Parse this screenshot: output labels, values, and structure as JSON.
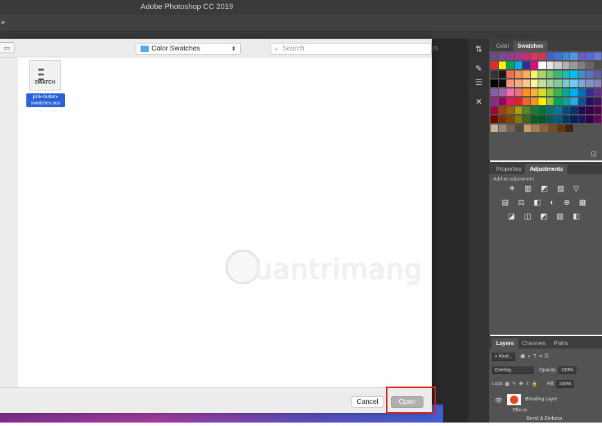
{
  "app": {
    "title": "Adobe Photoshop CC 2019",
    "menu_fragment": "e"
  },
  "document_tab_fragment": "25",
  "dialog": {
    "location": "Color Swatches",
    "search_placeholder": "Search",
    "files": [
      {
        "icon_label": "SWATCH",
        "name": "pink-button-swatches.aco",
        "selected": true
      }
    ],
    "cancel_label": "Cancel",
    "open_label": "Open",
    "open_highlight_color": "#e0211a"
  },
  "watermark": {
    "text": "uantrimang"
  },
  "color_panel": {
    "tabs": [
      "Color",
      "Swatches"
    ],
    "active_tab": "Swatches",
    "swatch_rows": [
      [
        "#6b4a8c",
        "#7b4a9b",
        "#8f3e93",
        "#a8368c",
        "#c0307a",
        "#d23a63",
        "#c73a4a",
        "#4a5fbe",
        "#3d74d3",
        "#3e8ad6",
        "#4c9be0",
        "#6b5ad0",
        "#5b68d8",
        "#6a7bdc"
      ],
      [
        "#f1252a",
        "#fff200",
        "#00a651",
        "#00aeef",
        "#2e3192",
        "#ec008c",
        "#ffffff",
        "#e6e6e6",
        "#cccccc",
        "#b3b3b3",
        "#999999",
        "#808080",
        "#666666",
        "#4d4d4d"
      ],
      [
        "#333333",
        "#1a1a1a",
        "#f26c4f",
        "#f68e55",
        "#fbaf5c",
        "#fff467",
        "#acd372",
        "#7cc576",
        "#3bb878",
        "#1abbb4",
        "#00bff3",
        "#438ccb",
        "#5574b9",
        "#605ca8"
      ],
      [
        "#000000",
        "#0d0d0d",
        "#f7977a",
        "#f9ad81",
        "#fdc68c",
        "#fff79a",
        "#c4df9b",
        "#a2d39c",
        "#82ca9c",
        "#7accc8",
        "#6dcff6",
        "#7da7d8",
        "#8393ca",
        "#8882be"
      ],
      [
        "#855fa8",
        "#a763a9",
        "#f06eaa",
        "#f26d7d",
        "#f7941d",
        "#fcb040",
        "#d7df23",
        "#8dc63f",
        "#39b54a",
        "#00a99d",
        "#00aeef",
        "#0072bc",
        "#2e3192",
        "#662d91"
      ],
      [
        "#92278f",
        "#9e005d",
        "#ed145b",
        "#ed1c24",
        "#f26522",
        "#f7941d",
        "#fff200",
        "#8dc63f",
        "#00a651",
        "#00a99d",
        "#27aae1",
        "#0054a6",
        "#1b1464",
        "#440e62"
      ],
      [
        "#9e0039",
        "#a0410d",
        "#a3620a",
        "#aba000",
        "#598527",
        "#197b30",
        "#007236",
        "#00746b",
        "#0076a3",
        "#004a80",
        "#003471",
        "#21085b",
        "#32004b",
        "#4b0049"
      ],
      [
        "#790000",
        "#7b2e00",
        "#7d4900",
        "#827b00",
        "#406618",
        "#005e20",
        "#005826",
        "#005952",
        "#005b7f",
        "#003663",
        "#002157",
        "#1b1464",
        "#32004b",
        "#630460"
      ],
      [
        "#c7b299",
        "#998675",
        "#736357",
        "#534741",
        "#c69c6d",
        "#a67c52",
        "#8c6239",
        "#754c24",
        "#603913",
        "#3c2415"
      ]
    ]
  },
  "adjustments_panel": {
    "tabs": [
      "Properties",
      "Adjustments"
    ],
    "active_tab": "Adjustments",
    "hint": "Add an adjustment",
    "icon_rows": [
      "☀ ▥ ◩ ▧ ▽",
      "▤ ⚖ ◧ ◐ ⊕ ▦",
      "◪ ◫ ◩ ▨ ◧"
    ]
  },
  "layers_panel": {
    "tabs": [
      "Layers",
      "Channels",
      "Paths"
    ],
    "active_tab": "Layers",
    "filter_label": "Kind",
    "blend_mode": "Overlay",
    "opacity_label": "Opacity:",
    "opacity_value": "100%",
    "lock_label": "Lock:",
    "fill_label": "Fill:",
    "fill_value": "100%",
    "layer_name": "Blending Layer",
    "effects_label": "Effects",
    "effect_item": "Bevel & Emboss",
    "layer_thumb_color": "#e8481c"
  }
}
